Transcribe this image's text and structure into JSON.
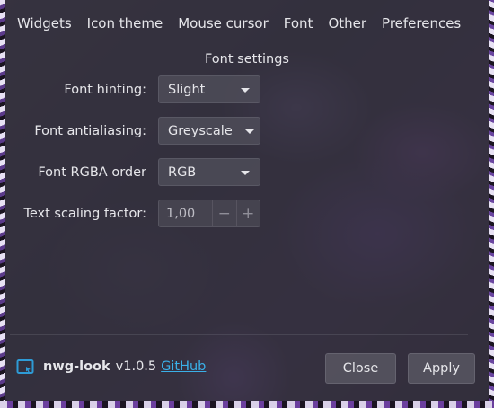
{
  "tabs": [
    {
      "label": "Widgets"
    },
    {
      "label": "Icon theme"
    },
    {
      "label": "Mouse cursor"
    },
    {
      "label": "Font"
    },
    {
      "label": "Other"
    },
    {
      "label": "Preferences"
    }
  ],
  "font_settings": {
    "title": "Font settings",
    "hinting": {
      "label": "Font hinting:",
      "value": "Slight"
    },
    "antialiasing": {
      "label": "Font antialiasing:",
      "value": "Greyscale"
    },
    "rgba_order": {
      "label": "Font RGBA order",
      "value": "RGB"
    },
    "text_scaling": {
      "label": "Text scaling factor:",
      "value": "1,00",
      "decrement": "−",
      "increment": "+"
    }
  },
  "footer": {
    "app_icon": "nwg-look-icon",
    "app_name": "nwg-look",
    "version": "v1.0.5",
    "link_text": "GitHub",
    "close_label": "Close",
    "apply_label": "Apply"
  },
  "colors": {
    "link": "#3ab0e8",
    "accent_icon": "#2e9bd6"
  }
}
